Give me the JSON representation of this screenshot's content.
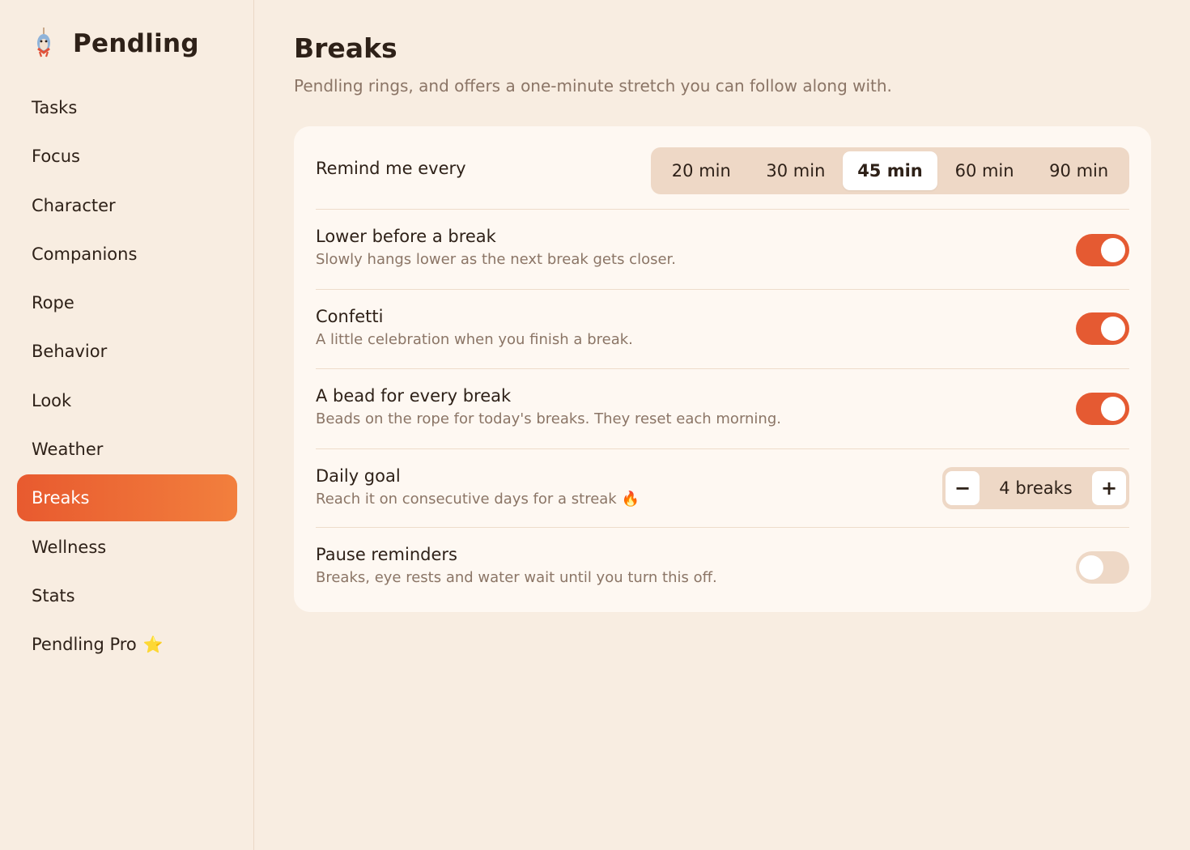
{
  "app": {
    "name": "Pendling"
  },
  "sidebar": {
    "items": [
      {
        "label": "Tasks"
      },
      {
        "label": "Focus"
      },
      {
        "label": "Character"
      },
      {
        "label": "Companions"
      },
      {
        "label": "Rope"
      },
      {
        "label": "Behavior"
      },
      {
        "label": "Look"
      },
      {
        "label": "Weather"
      },
      {
        "label": "Breaks",
        "active": true
      },
      {
        "label": "Wellness"
      },
      {
        "label": "Stats"
      },
      {
        "label": "Pendling Pro",
        "badge": "⭐"
      }
    ]
  },
  "page": {
    "title": "Breaks",
    "subtitle": "Pendling rings, and offers a one-minute stretch you can follow along with."
  },
  "settings": {
    "remind": {
      "label": "Remind me every",
      "options": [
        "20 min",
        "30 min",
        "45 min",
        "60 min",
        "90 min"
      ],
      "selected": "45 min"
    },
    "lower": {
      "title": "Lower before a break",
      "desc": "Slowly hangs lower as the next break gets closer.",
      "on": true
    },
    "confetti": {
      "title": "Confetti",
      "desc": "A little celebration when you finish a break.",
      "on": true
    },
    "bead": {
      "title": "A bead for every break",
      "desc": "Beads on the rope for today's breaks. They reset each morning.",
      "on": true
    },
    "goal": {
      "title": "Daily goal",
      "desc": "Reach it on consecutive days for a streak 🔥",
      "value": "4 breaks",
      "minus": "−",
      "plus": "+"
    },
    "pause": {
      "title": "Pause reminders",
      "desc": "Breaks, eye rests and water wait until you turn this off.",
      "on": false
    }
  },
  "colors": {
    "accent": "#e85a2f",
    "background": "#f8ede1",
    "card": "#fef8f2",
    "segment_bg": "#eed8c6"
  }
}
